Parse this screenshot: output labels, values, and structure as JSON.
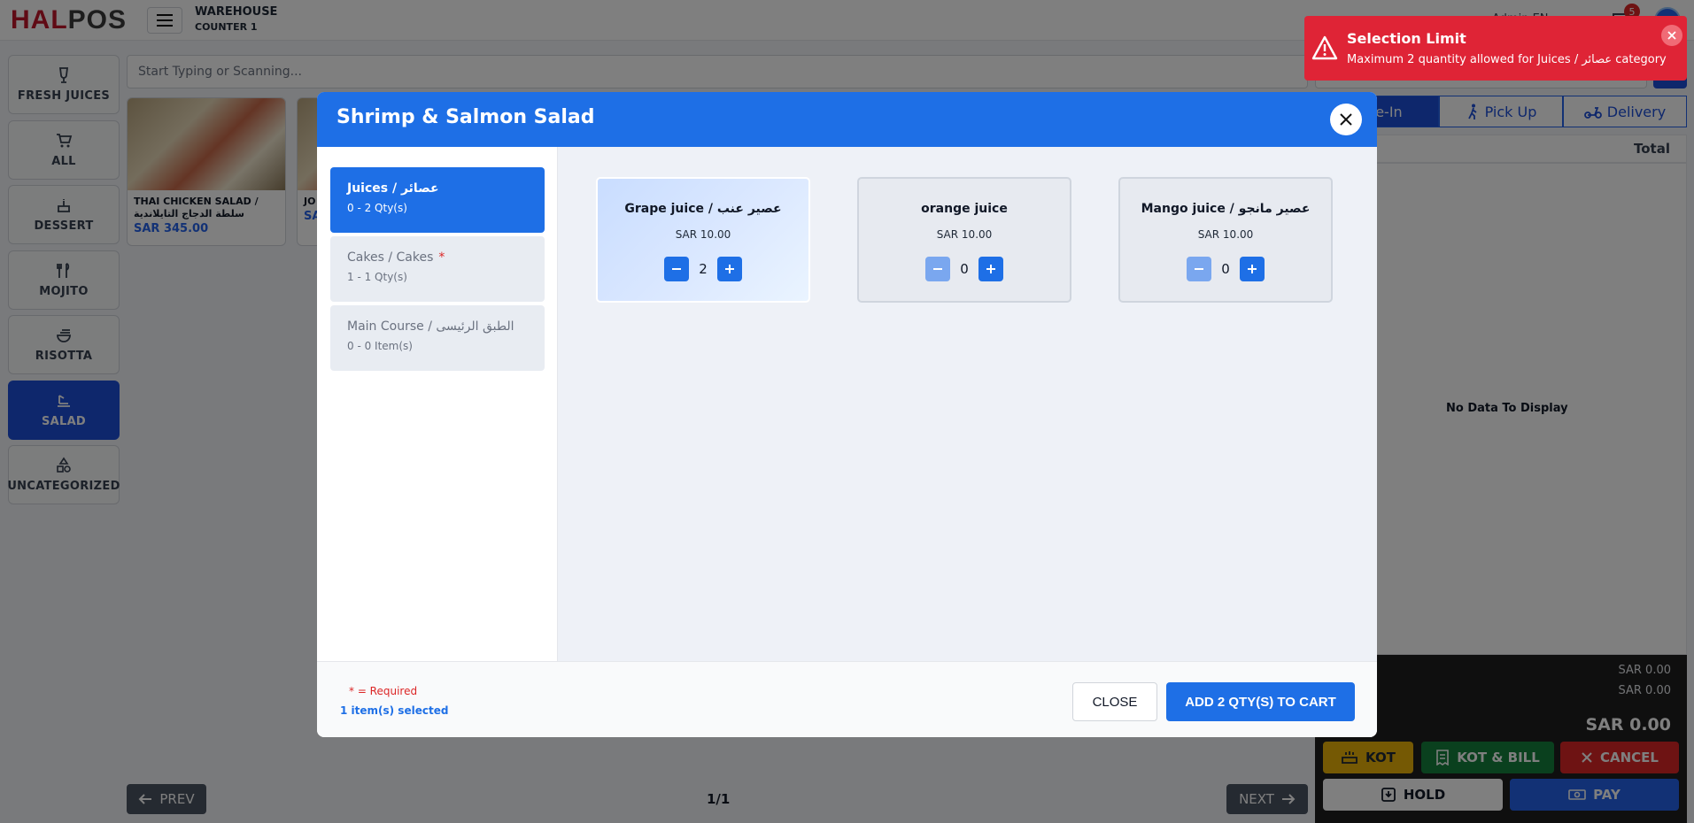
{
  "app": {
    "logo_hal": "HAL",
    "logo_pos": "POS",
    "warehouse": "WAREHOUSE",
    "counter": "COUNTER 1",
    "user_partial": "Admin EN",
    "notification_count": "5"
  },
  "sidebar": {
    "items": [
      {
        "label": "FRESH JUICES",
        "icon": "glass-icon"
      },
      {
        "label": "ALL",
        "icon": "cart-icon"
      },
      {
        "label": "DESSERT",
        "icon": "cake-icon"
      },
      {
        "label": "MOJITO",
        "icon": "cutlery-icon"
      },
      {
        "label": "RISOTTA",
        "icon": "bowl-icon"
      },
      {
        "label": "SALAD",
        "icon": "salad-icon"
      },
      {
        "label": "UNCATEGORIZED",
        "icon": "shapes-icon"
      }
    ],
    "active": "SALAD"
  },
  "search": {
    "placeholder": "Start Typing or Scanning..."
  },
  "products": [
    {
      "name": "THAI CHICKEN SALAD / سلطة الدجاج التايلاندية",
      "price": "SAR 345.00"
    },
    {
      "name": "JO",
      "price": "SA"
    }
  ],
  "order": {
    "tabs": [
      {
        "label": "Dine-In",
        "active": true
      },
      {
        "label": "Pick Up"
      },
      {
        "label": "Delivery"
      }
    ],
    "total_header": "Total",
    "empty_text": "No Data To Display",
    "subtotal": "SAR 0.00",
    "tax": "SAR 0.00",
    "grand_total": "SAR 0.00",
    "actions": {
      "kot": "KOT",
      "kot_bill": "KOT & BILL",
      "cancel": "CANCEL",
      "hold": "HOLD",
      "pay": "PAY"
    }
  },
  "pager": {
    "prev": "PREV",
    "next": "NEXT",
    "page": "1/1"
  },
  "modal": {
    "title": "Shrimp & Salmon Salad",
    "groups": [
      {
        "name": "Juices / عصائر",
        "qty": "0 - 2 Qty(s)",
        "required": false,
        "active": true
      },
      {
        "name": "Cakes / Cakes",
        "qty": "1 - 1 Qty(s)",
        "required": true,
        "active": false
      },
      {
        "name": "Main Course / الطبق الرئيسى",
        "qty": "0 - 0 Item(s)",
        "required": false,
        "active": false
      }
    ],
    "items": [
      {
        "name": "Grape juice / عصير عنب",
        "price": "SAR 10.00",
        "qty": "2",
        "selected": true
      },
      {
        "name": "orange juice",
        "price": "SAR 10.00",
        "qty": "0",
        "selected": false
      },
      {
        "name": "Mango juice / عصير مانجو",
        "price": "SAR 10.00",
        "qty": "0",
        "selected": false
      }
    ],
    "required_note": "* = Required",
    "selected_note": "1 item(s) selected",
    "close_label": "CLOSE",
    "add_label": "ADD 2 QTY(S) TO CART"
  },
  "toast": {
    "title": "Selection Limit",
    "message": "Maximum 2 quantity allowed for Juices / عصائر category"
  },
  "colors": {
    "primary": "#1e6fe6",
    "danger": "#df2436",
    "brand_red": "#c0162b"
  }
}
